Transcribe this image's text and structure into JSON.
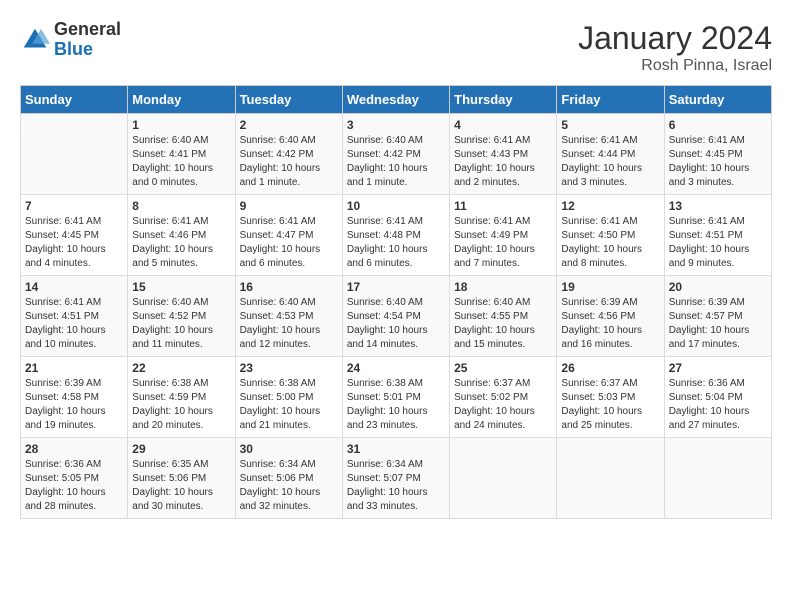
{
  "header": {
    "logo_general": "General",
    "logo_blue": "Blue",
    "title": "January 2024",
    "location": "Rosh Pinna, Israel"
  },
  "weekdays": [
    "Sunday",
    "Monday",
    "Tuesday",
    "Wednesday",
    "Thursday",
    "Friday",
    "Saturday"
  ],
  "weeks": [
    [
      {
        "day": "",
        "sunrise": "",
        "sunset": "",
        "daylight": ""
      },
      {
        "day": "1",
        "sunrise": "Sunrise: 6:40 AM",
        "sunset": "Sunset: 4:41 PM",
        "daylight": "Daylight: 10 hours and 0 minutes."
      },
      {
        "day": "2",
        "sunrise": "Sunrise: 6:40 AM",
        "sunset": "Sunset: 4:42 PM",
        "daylight": "Daylight: 10 hours and 1 minute."
      },
      {
        "day": "3",
        "sunrise": "Sunrise: 6:40 AM",
        "sunset": "Sunset: 4:42 PM",
        "daylight": "Daylight: 10 hours and 1 minute."
      },
      {
        "day": "4",
        "sunrise": "Sunrise: 6:41 AM",
        "sunset": "Sunset: 4:43 PM",
        "daylight": "Daylight: 10 hours and 2 minutes."
      },
      {
        "day": "5",
        "sunrise": "Sunrise: 6:41 AM",
        "sunset": "Sunset: 4:44 PM",
        "daylight": "Daylight: 10 hours and 3 minutes."
      },
      {
        "day": "6",
        "sunrise": "Sunrise: 6:41 AM",
        "sunset": "Sunset: 4:45 PM",
        "daylight": "Daylight: 10 hours and 3 minutes."
      }
    ],
    [
      {
        "day": "7",
        "sunrise": "Sunrise: 6:41 AM",
        "sunset": "Sunset: 4:45 PM",
        "daylight": "Daylight: 10 hours and 4 minutes."
      },
      {
        "day": "8",
        "sunrise": "Sunrise: 6:41 AM",
        "sunset": "Sunset: 4:46 PM",
        "daylight": "Daylight: 10 hours and 5 minutes."
      },
      {
        "day": "9",
        "sunrise": "Sunrise: 6:41 AM",
        "sunset": "Sunset: 4:47 PM",
        "daylight": "Daylight: 10 hours and 6 minutes."
      },
      {
        "day": "10",
        "sunrise": "Sunrise: 6:41 AM",
        "sunset": "Sunset: 4:48 PM",
        "daylight": "Daylight: 10 hours and 6 minutes."
      },
      {
        "day": "11",
        "sunrise": "Sunrise: 6:41 AM",
        "sunset": "Sunset: 4:49 PM",
        "daylight": "Daylight: 10 hours and 7 minutes."
      },
      {
        "day": "12",
        "sunrise": "Sunrise: 6:41 AM",
        "sunset": "Sunset: 4:50 PM",
        "daylight": "Daylight: 10 hours and 8 minutes."
      },
      {
        "day": "13",
        "sunrise": "Sunrise: 6:41 AM",
        "sunset": "Sunset: 4:51 PM",
        "daylight": "Daylight: 10 hours and 9 minutes."
      }
    ],
    [
      {
        "day": "14",
        "sunrise": "Sunrise: 6:41 AM",
        "sunset": "Sunset: 4:51 PM",
        "daylight": "Daylight: 10 hours and 10 minutes."
      },
      {
        "day": "15",
        "sunrise": "Sunrise: 6:40 AM",
        "sunset": "Sunset: 4:52 PM",
        "daylight": "Daylight: 10 hours and 11 minutes."
      },
      {
        "day": "16",
        "sunrise": "Sunrise: 6:40 AM",
        "sunset": "Sunset: 4:53 PM",
        "daylight": "Daylight: 10 hours and 12 minutes."
      },
      {
        "day": "17",
        "sunrise": "Sunrise: 6:40 AM",
        "sunset": "Sunset: 4:54 PM",
        "daylight": "Daylight: 10 hours and 14 minutes."
      },
      {
        "day": "18",
        "sunrise": "Sunrise: 6:40 AM",
        "sunset": "Sunset: 4:55 PM",
        "daylight": "Daylight: 10 hours and 15 minutes."
      },
      {
        "day": "19",
        "sunrise": "Sunrise: 6:39 AM",
        "sunset": "Sunset: 4:56 PM",
        "daylight": "Daylight: 10 hours and 16 minutes."
      },
      {
        "day": "20",
        "sunrise": "Sunrise: 6:39 AM",
        "sunset": "Sunset: 4:57 PM",
        "daylight": "Daylight: 10 hours and 17 minutes."
      }
    ],
    [
      {
        "day": "21",
        "sunrise": "Sunrise: 6:39 AM",
        "sunset": "Sunset: 4:58 PM",
        "daylight": "Daylight: 10 hours and 19 minutes."
      },
      {
        "day": "22",
        "sunrise": "Sunrise: 6:38 AM",
        "sunset": "Sunset: 4:59 PM",
        "daylight": "Daylight: 10 hours and 20 minutes."
      },
      {
        "day": "23",
        "sunrise": "Sunrise: 6:38 AM",
        "sunset": "Sunset: 5:00 PM",
        "daylight": "Daylight: 10 hours and 21 minutes."
      },
      {
        "day": "24",
        "sunrise": "Sunrise: 6:38 AM",
        "sunset": "Sunset: 5:01 PM",
        "daylight": "Daylight: 10 hours and 23 minutes."
      },
      {
        "day": "25",
        "sunrise": "Sunrise: 6:37 AM",
        "sunset": "Sunset: 5:02 PM",
        "daylight": "Daylight: 10 hours and 24 minutes."
      },
      {
        "day": "26",
        "sunrise": "Sunrise: 6:37 AM",
        "sunset": "Sunset: 5:03 PM",
        "daylight": "Daylight: 10 hours and 25 minutes."
      },
      {
        "day": "27",
        "sunrise": "Sunrise: 6:36 AM",
        "sunset": "Sunset: 5:04 PM",
        "daylight": "Daylight: 10 hours and 27 minutes."
      }
    ],
    [
      {
        "day": "28",
        "sunrise": "Sunrise: 6:36 AM",
        "sunset": "Sunset: 5:05 PM",
        "daylight": "Daylight: 10 hours and 28 minutes."
      },
      {
        "day": "29",
        "sunrise": "Sunrise: 6:35 AM",
        "sunset": "Sunset: 5:06 PM",
        "daylight": "Daylight: 10 hours and 30 minutes."
      },
      {
        "day": "30",
        "sunrise": "Sunrise: 6:34 AM",
        "sunset": "Sunset: 5:06 PM",
        "daylight": "Daylight: 10 hours and 32 minutes."
      },
      {
        "day": "31",
        "sunrise": "Sunrise: 6:34 AM",
        "sunset": "Sunset: 5:07 PM",
        "daylight": "Daylight: 10 hours and 33 minutes."
      },
      {
        "day": "",
        "sunrise": "",
        "sunset": "",
        "daylight": ""
      },
      {
        "day": "",
        "sunrise": "",
        "sunset": "",
        "daylight": ""
      },
      {
        "day": "",
        "sunrise": "",
        "sunset": "",
        "daylight": ""
      }
    ]
  ]
}
